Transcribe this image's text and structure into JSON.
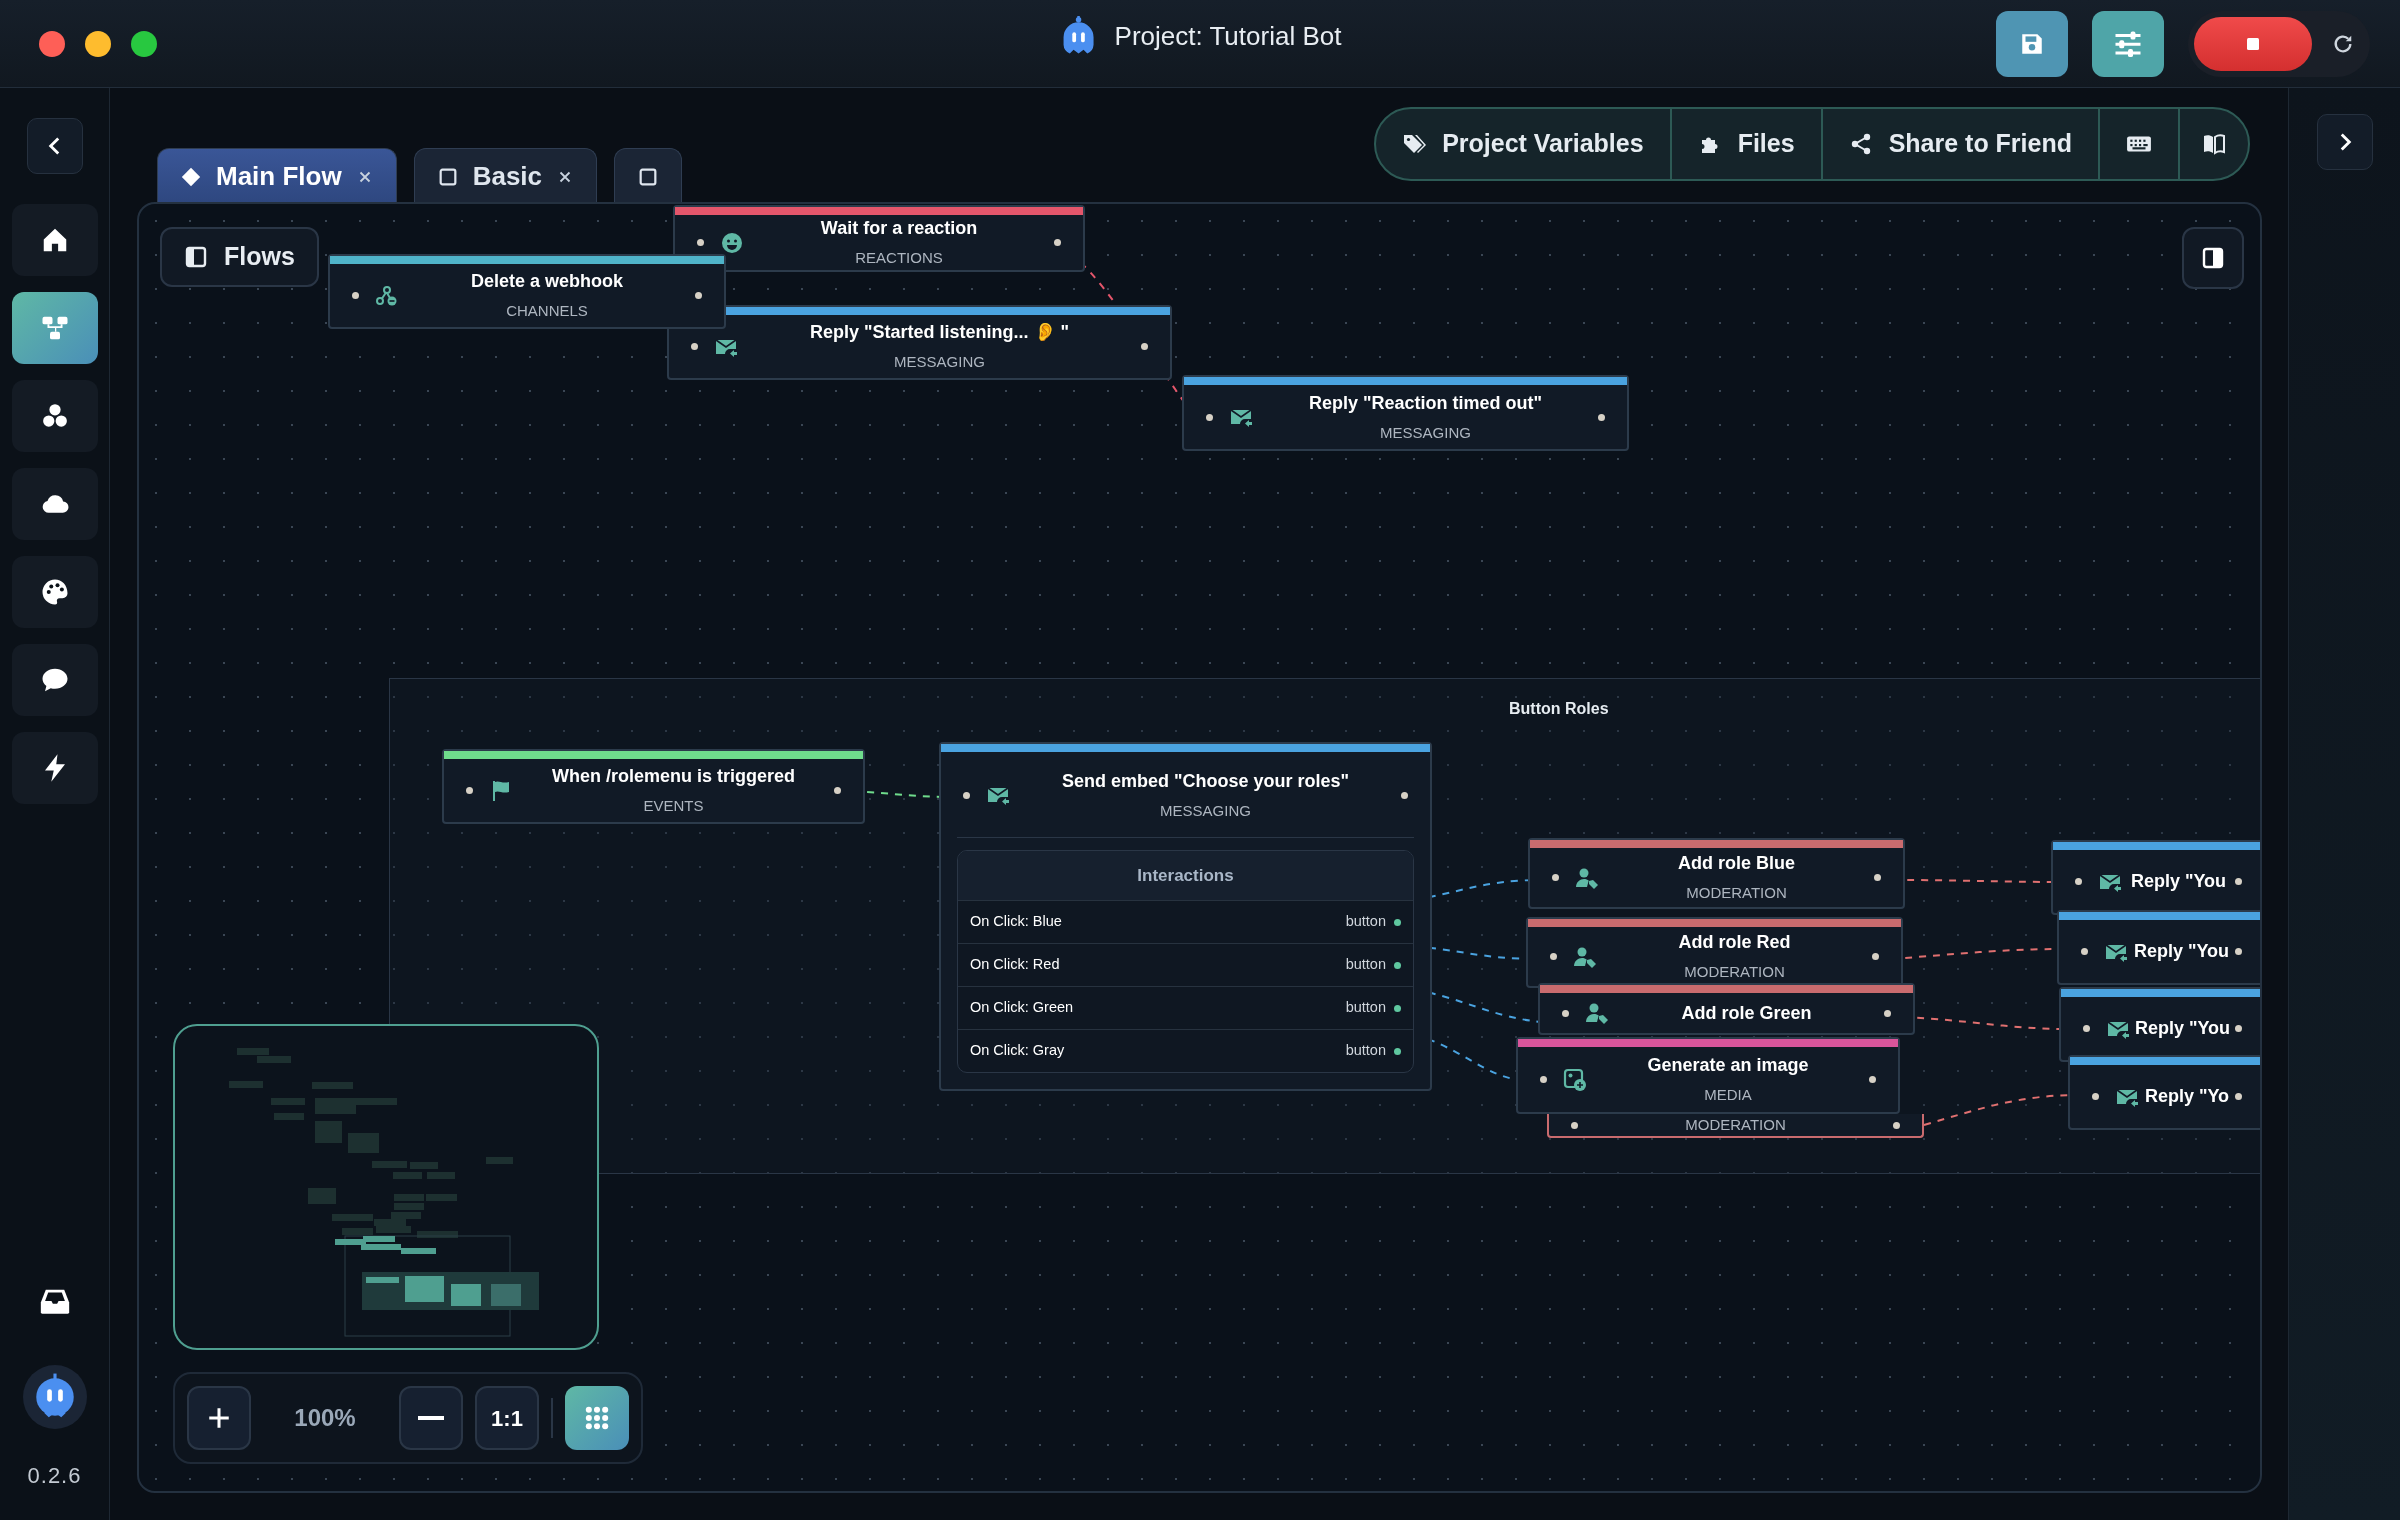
{
  "window": {
    "title": "Project: Tutorial Bot",
    "bot_running": true
  },
  "sidebar": {
    "items": [
      {
        "selected": false
      },
      {
        "selected": true
      },
      {
        "selected": false
      },
      {
        "selected": false
      },
      {
        "selected": false
      },
      {
        "selected": false
      },
      {
        "selected": false
      }
    ],
    "version": "0.2.6"
  },
  "tabs": [
    {
      "kind": "main",
      "label": "Main Flow",
      "selected": true,
      "closable": true
    },
    {
      "kind": "flow",
      "label": "Basic",
      "selected": false,
      "closable": true
    },
    {
      "kind": "flow",
      "selected": false,
      "closable": false
    }
  ],
  "toolbar": [
    "Project Variables",
    "Files",
    "Share to Friend"
  ],
  "canvas": {
    "flows_button": "Flows",
    "group": {
      "label": "Button Roles"
    },
    "nodes": [
      {
        "kind": "reactions",
        "title": "Wait for a reaction",
        "category": "REACTIONS",
        "color": "#e5566b"
      },
      {
        "kind": "channels",
        "title": "Delete a webhook",
        "category": "CHANNELS",
        "color": "#4fb3c9"
      },
      {
        "kind": "messaging",
        "title": "Reply \"Started listening... 👂 \"",
        "category": "MESSAGING",
        "color": "#4aa3e0"
      },
      {
        "kind": "messaging",
        "title": "Reply \"Reaction timed out\"",
        "category": "MESSAGING",
        "color": "#4aa3e0"
      },
      {
        "kind": "events",
        "title": "When /rolemenu is triggered",
        "category": "EVENTS",
        "color": "#6fdc8c"
      },
      {
        "kind": "messaging",
        "title": "Send embed \"Choose your roles\"",
        "category": "MESSAGING",
        "color": "#4aa3e0",
        "interactions": {
          "header": "Interactions",
          "items": [
            {
              "label": "On Click: Blue",
              "type": "button"
            },
            {
              "label": "On Click: Red",
              "type": "button"
            },
            {
              "label": "On Click: Green",
              "type": "button"
            },
            {
              "label": "On Click: Gray",
              "type": "button"
            }
          ]
        }
      },
      {
        "kind": "moderation",
        "title": "Add role Blue",
        "category": "MODERATION",
        "color": "#c96b6e"
      },
      {
        "kind": "moderation",
        "title": "Add role Red",
        "category": "MODERATION",
        "color": "#c96b6e"
      },
      {
        "kind": "moderation",
        "title": "Add role Green",
        "color": "#c96b6e"
      },
      {
        "kind": "media",
        "title": "Generate an image",
        "category": "MEDIA",
        "color": "#d9559b"
      },
      {
        "category": "MODERATION",
        "color": "#c96b6e"
      },
      {
        "kind": "messaging",
        "title": "Reply \"You",
        "color": "#4aa3e0"
      },
      {
        "kind": "messaging",
        "title": "Reply \"You",
        "color": "#4aa3e0"
      },
      {
        "kind": "messaging",
        "title": "Reply \"You",
        "color": "#4aa3e0"
      },
      {
        "kind": "messaging",
        "title": "Reply \"Yo",
        "color": "#4aa3e0"
      }
    ]
  },
  "zoom": {
    "percent": "100%",
    "reset": "1:1",
    "grid_on": true
  }
}
